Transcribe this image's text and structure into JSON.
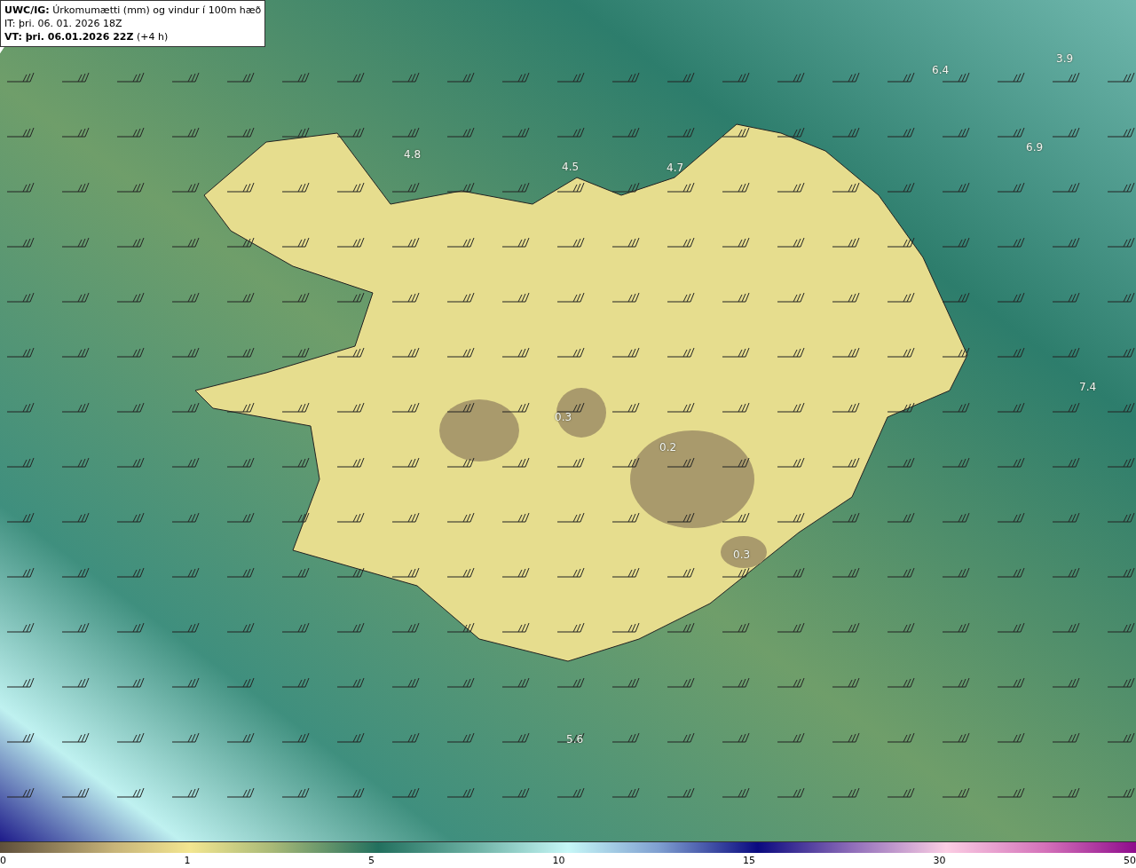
{
  "title_box": {
    "line_1": "**UWC/IG:** Úrkomumætti (mm) og vindur í 100m hæð",
    "line_2": "IT: þri. 06. 01. 2026 18Z",
    "line_3": "**VT: þri. 06.01.2026 22Z** (+4 h)"
  },
  "map": {
    "value_labels": [
      "4.8",
      "4.5",
      "4.7",
      "6.4",
      "3.9",
      "6.9",
      "7.4",
      "0.3",
      "0.2",
      "0.3",
      "5.6"
    ]
  },
  "colorbar": {
    "ticks": [
      "0",
      "1",
      "5",
      "10",
      "15",
      "30",
      "50"
    ]
  }
}
